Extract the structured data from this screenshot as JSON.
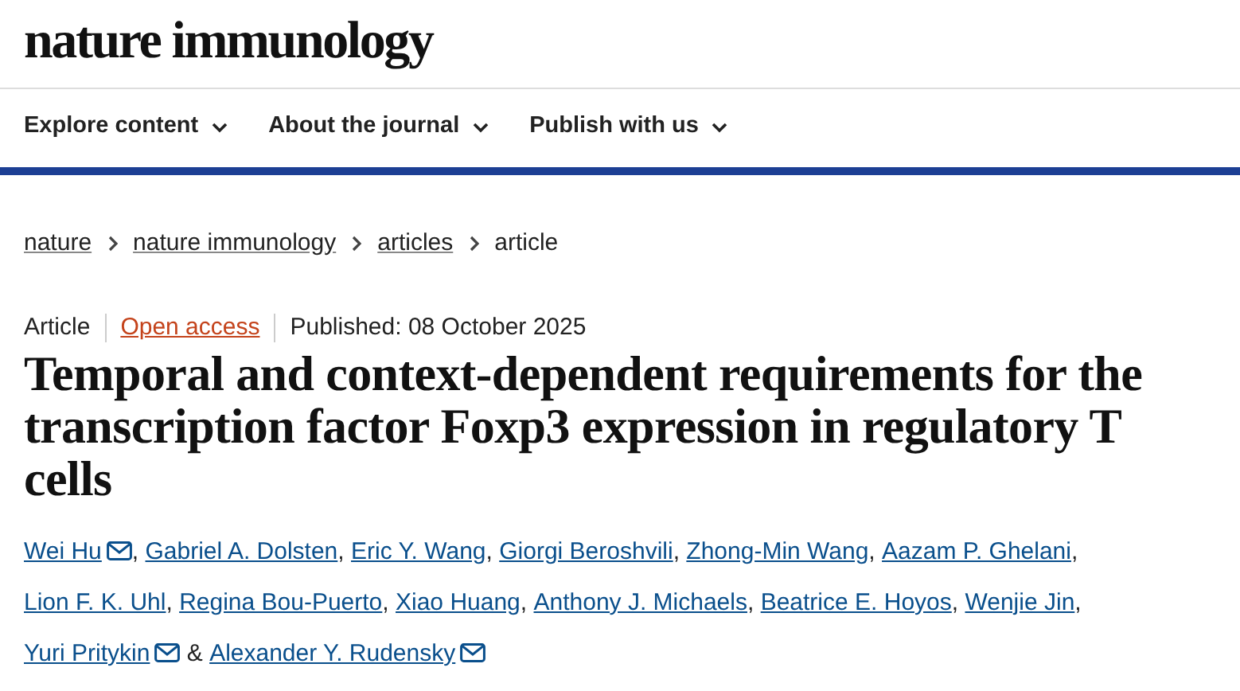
{
  "logo": "nature immunology",
  "nav": [
    {
      "label": "Explore content",
      "expanded": false
    },
    {
      "label": "About the journal",
      "expanded": false
    },
    {
      "label": "Publish with us",
      "expanded": false
    }
  ],
  "breadcrumbs": [
    {
      "label": "nature",
      "kind": "link"
    },
    {
      "label": "nature immunology",
      "kind": "link"
    },
    {
      "label": "articles",
      "kind": "link"
    },
    {
      "label": "article",
      "kind": "current"
    }
  ],
  "meta": [
    {
      "text": "Article",
      "kind": "text"
    },
    {
      "text": "Open access",
      "kind": "link"
    },
    {
      "text": "Published: 08 October 2025",
      "kind": "text"
    }
  ],
  "title": "Temporal and context-dependent requirements for the transcription factor Foxp3 expression in regulatory T cells",
  "authors": [
    {
      "name": "Wei Hu",
      "email": true,
      "sep": ","
    },
    {
      "name": "Gabriel A. Dolsten",
      "email": false,
      "sep": ","
    },
    {
      "name": "Eric Y. Wang",
      "email": false,
      "sep": ","
    },
    {
      "name": "Giorgi Beroshvili",
      "email": false,
      "sep": ","
    },
    {
      "name": "Zhong-Min Wang",
      "email": false,
      "sep": ","
    },
    {
      "name": "Aazam P. Ghelani",
      "email": false,
      "sep": ","
    },
    {
      "name": "Lion F. K. Uhl",
      "email": false,
      "sep": ","
    },
    {
      "name": "Regina Bou-Puerto",
      "email": false,
      "sep": ","
    },
    {
      "name": "Xiao Huang",
      "email": false,
      "sep": ","
    },
    {
      "name": "Anthony J. Michaels",
      "email": false,
      "sep": ","
    },
    {
      "name": "Beatrice E. Hoyos",
      "email": false,
      "sep": ","
    },
    {
      "name": "Wenjie Jin",
      "email": false,
      "sep": ","
    },
    {
      "name": "Yuri Pritykin",
      "email": true,
      "sep": "&"
    },
    {
      "name": "Alexander Y. Rudensky",
      "email": true
    }
  ]
}
